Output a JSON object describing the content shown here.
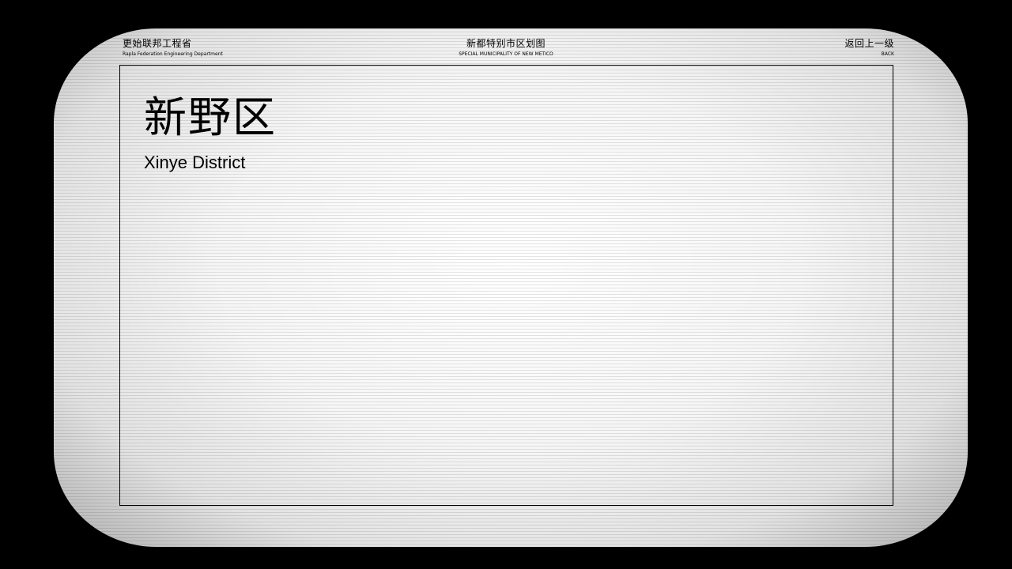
{
  "header": {
    "left": {
      "cn": "更始联邦工程省",
      "en": "Rapla Federation Engineering Department"
    },
    "center": {
      "cn": "新都特别市区划图",
      "en": "SPECIAL MUNICIPALITY OF NEW METICO"
    },
    "back": {
      "cn": "返回上一级",
      "en": "BACK"
    }
  },
  "district": {
    "name_cn": "新野区",
    "name_en": "Xinye District"
  },
  "colors": {
    "background": "#000000",
    "screen": "#f4f4f4",
    "text": "#000000"
  }
}
